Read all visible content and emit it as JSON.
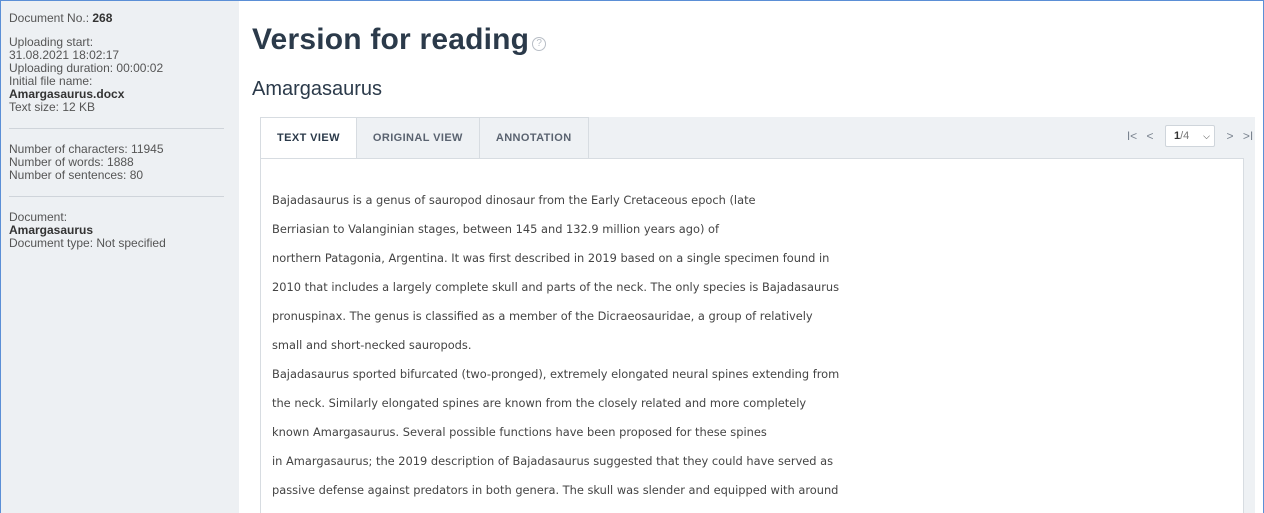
{
  "sidebar": {
    "doc_no_label": "Document No.: ",
    "doc_no_value": "268",
    "upload_start_label": "Uploading start:",
    "upload_start_value": "31.08.2021 18:02:17",
    "upload_duration": "Uploading duration: 00:00:02",
    "initial_file_label": "Initial file name:",
    "initial_file_value": "Amargasaurus.docx",
    "text_size": "Text size: 12 KB",
    "num_chars": "Number of characters: 11945",
    "num_words": "Number of words: 1888",
    "num_sentences": "Number of sentences: 80",
    "document_label": "Document:",
    "document_value": "Amargasaurus",
    "document_type": "Document type: Not specified"
  },
  "main": {
    "title": "Version for reading",
    "help_icon": "?",
    "doc_name": "Amargasaurus"
  },
  "tabs": [
    {
      "label": "TEXT VIEW",
      "active": true
    },
    {
      "label": "ORIGINAL VIEW",
      "active": false
    },
    {
      "label": "ANNOTATION",
      "active": false
    }
  ],
  "pager": {
    "first_icon": "I<",
    "prev_icon": "<",
    "current": "1",
    "total": "/4",
    "next_icon": ">",
    "last_icon": ">I"
  },
  "text_lines": [
    "Bajadasaurus is a genus of sauropod dinosaur from the Early Cretaceous epoch (late",
    "Berriasian to Valanginian stages, between 145 and 132.9 million years ago) of",
    "northern Patagonia, Argentina. It was first described in 2019 based on a single specimen found in",
    "2010 that includes a largely complete skull and parts of the neck. The only species is Bajadasaurus",
    "pronuspinax. The genus is classified as a member of the Dicraeosauridae, a group of relatively",
    "small and short-necked sauropods.",
    "Bajadasaurus sported bifurcated (two-pronged), extremely elongated neural spines extending from",
    "the neck. Similarly elongated spines are known from the closely related and more completely",
    "known Amargasaurus. Several possible functions have been proposed for these spines",
    "in Amargasaurus; the 2019 description of Bajadasaurus suggested that they could have served as",
    "passive defense against predators in both genera. The skull was slender and equipped with around"
  ],
  "colors": {
    "sidebar_bg": "#edf0f3",
    "title": "#2b3a4a",
    "frame_border": "#5b8fd6"
  }
}
